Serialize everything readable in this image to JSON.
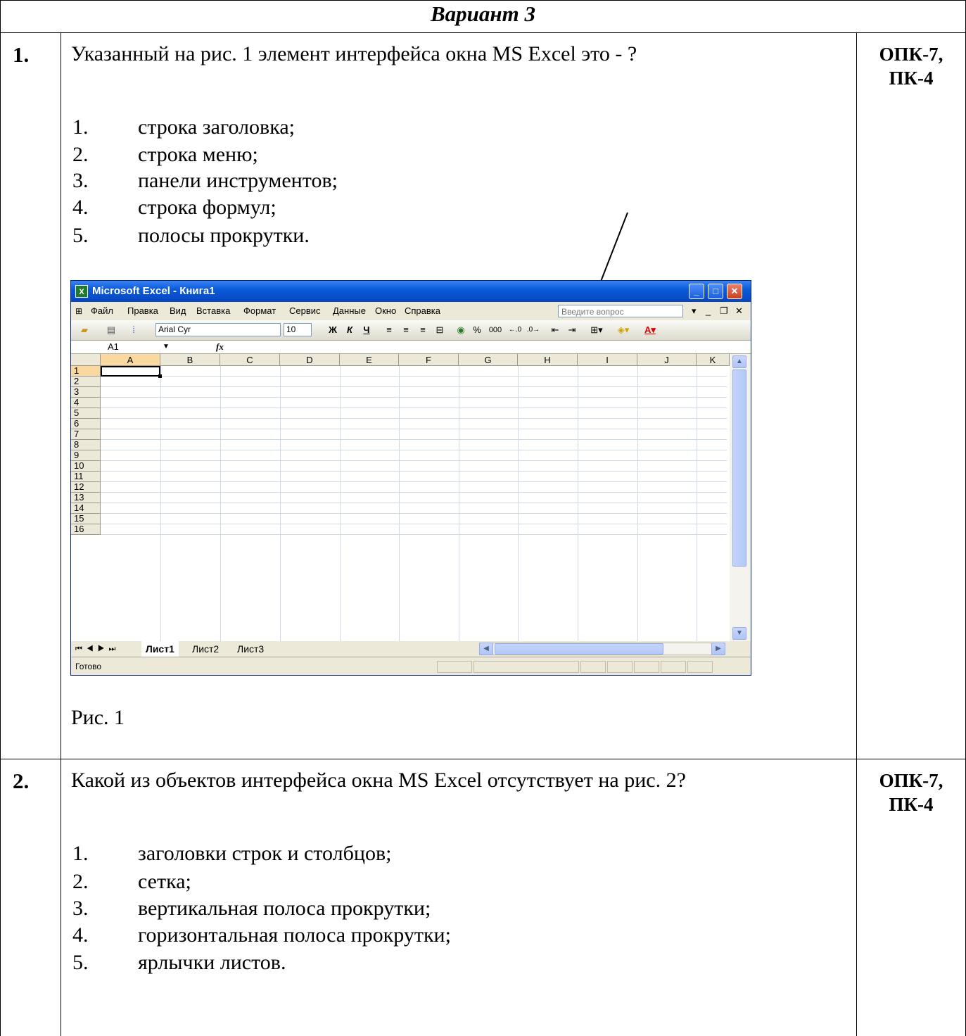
{
  "header": {
    "variant": "Вариант 3"
  },
  "questions": [
    {
      "number": "1.",
      "text": "Указанный на рис. 1 элемент интерфейса окна MS Excel это - ?",
      "competency": [
        "ОПК-7,",
        "ПК-4"
      ],
      "options": [
        {
          "n": "1.",
          "t": "строка заголовка;"
        },
        {
          "n": "2.",
          "t": "строка меню;"
        },
        {
          "n": "3.",
          "t": "панели инструментов;"
        },
        {
          "n": "4.",
          "t": "строка формул;"
        },
        {
          "n": "5.",
          "t": "полосы прокрутки."
        }
      ],
      "caption": "Рис. 1"
    },
    {
      "number": "2.",
      "text": "Какой из объектов интерфейса окна MS Excel отсутствует на рис. 2?",
      "competency": [
        "ОПК-7,",
        "ПК-4"
      ],
      "options": [
        {
          "n": "1.",
          "t": "заголовки строк и столбцов;"
        },
        {
          "n": "2.",
          "t": "сетка;"
        },
        {
          "n": "3.",
          "t": "вертикальная полоса прокрутки;"
        },
        {
          "n": "4.",
          "t": "горизонтальная полоса прокрутки;"
        },
        {
          "n": "5.",
          "t": "ярлычки листов."
        }
      ]
    }
  ],
  "excel": {
    "title": "Microsoft Excel - Книга1",
    "menu": [
      "Файл",
      "Правка",
      "Вид",
      "Вставка",
      "Формат",
      "Сервис",
      "Данные",
      "Окно",
      "Справка"
    ],
    "ask_placeholder": "Введите вопрос",
    "font_name": "Arial Cyr",
    "font_size": "10",
    "bold": "Ж",
    "italic": "К",
    "underline": "Ч",
    "percent": "%",
    "thousands": "000",
    "name_box": "A1",
    "fx": "fx",
    "columns": [
      "A",
      "B",
      "C",
      "D",
      "E",
      "F",
      "G",
      "H",
      "I",
      "J",
      "K"
    ],
    "rows": [
      "1",
      "2",
      "3",
      "4",
      "5",
      "6",
      "7",
      "8",
      "9",
      "10",
      "11",
      "12",
      "13",
      "14",
      "15",
      "16"
    ],
    "sheets": [
      "Лист1",
      "Лист2",
      "Лист3"
    ],
    "status": "Готово"
  },
  "colors": {
    "titlebar": "#0a5bd9",
    "chrome": "#ece9d8",
    "gridline": "#d0d7e5"
  }
}
